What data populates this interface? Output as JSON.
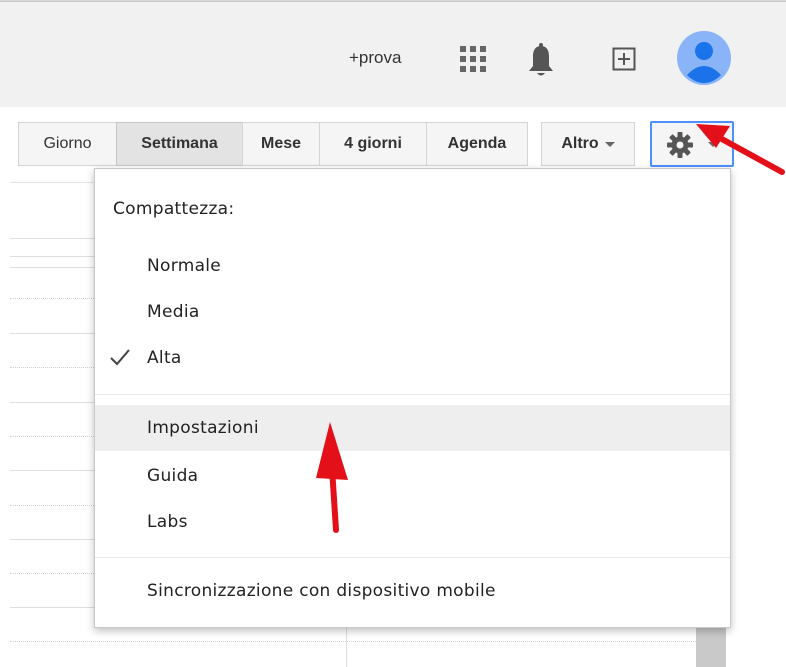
{
  "header": {
    "account_link": "+prova",
    "icons": [
      "apps-grid-icon",
      "notifications-bell-icon",
      "add-box-icon",
      "account-avatar-icon"
    ]
  },
  "view_toolbar": {
    "buttons": [
      "Giorno",
      "Settimana",
      "Mese",
      "4 giorni",
      "Agenda"
    ],
    "active": "Settimana",
    "more_label": "Altro",
    "settings_icon": "gear-icon"
  },
  "settings_menu": {
    "heading": "Compattezza:",
    "density_options": [
      "Normale",
      "Media",
      "Alta"
    ],
    "selected_density": "Alta",
    "items": [
      "Impostazioni",
      "Guida",
      "Labs"
    ],
    "highlighted_item": "Impostazioni",
    "mobile_sync": "Sincronizzazione con dispositivo mobile"
  },
  "colors": {
    "accent_border": "#4d90fe",
    "avatar_bg": "#8ab4f8",
    "avatar_fg": "#1a73e8",
    "annotation_arrow": "#e3101a",
    "highlight_bg": "#eeeeee"
  }
}
